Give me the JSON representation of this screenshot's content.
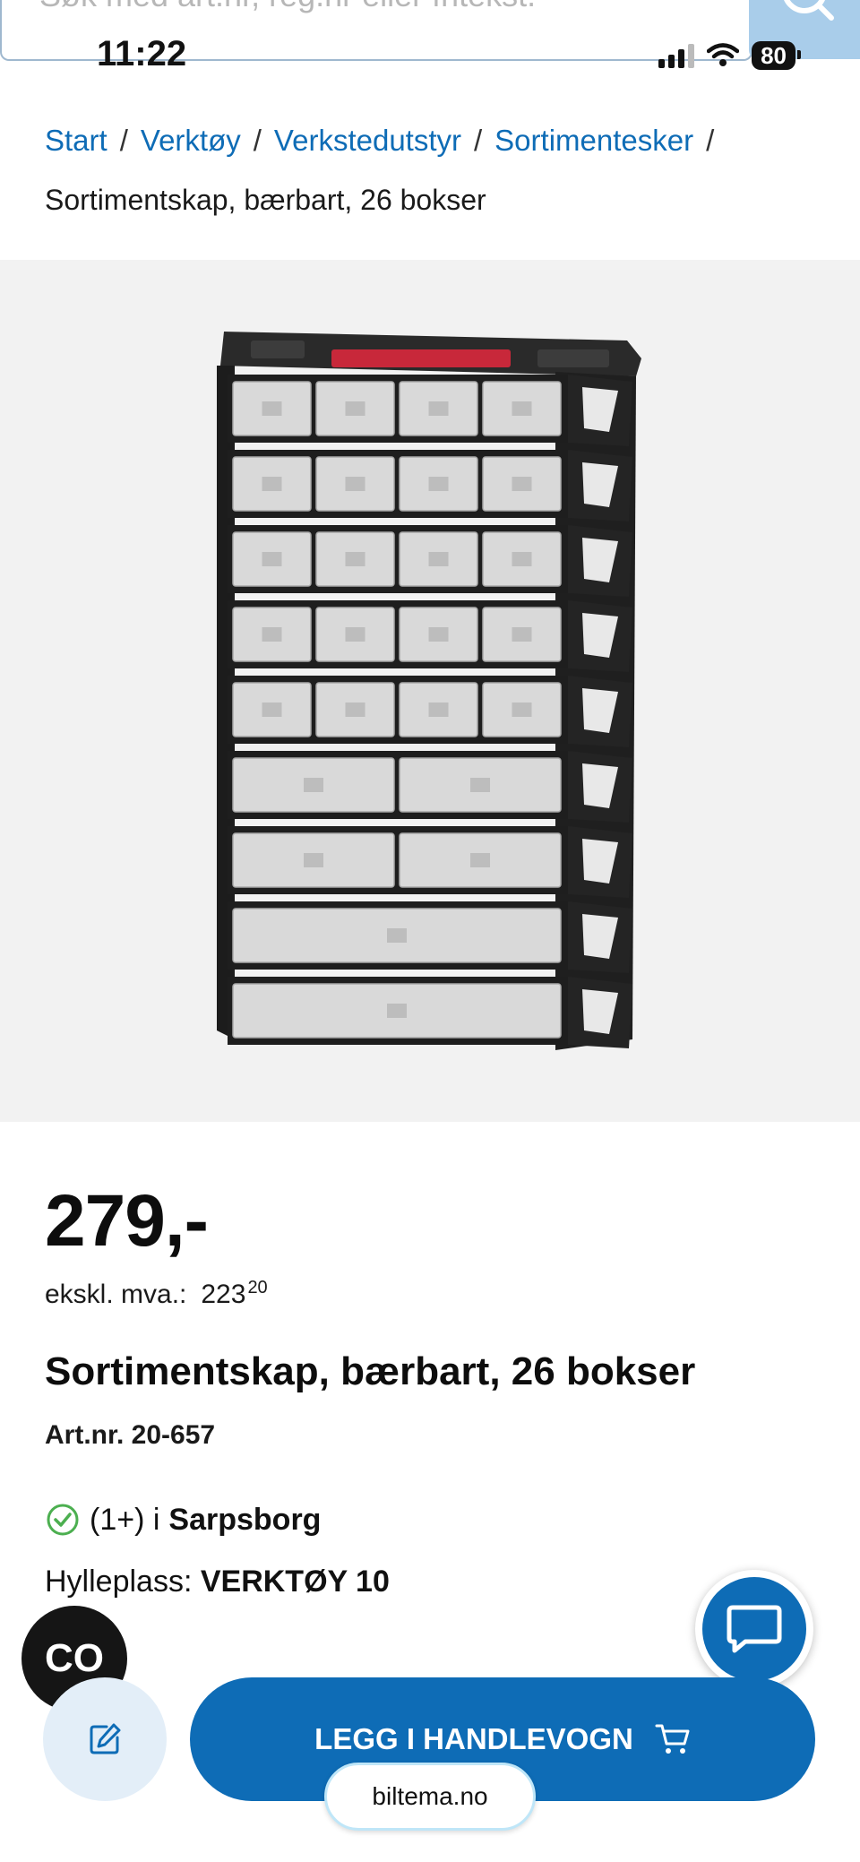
{
  "search": {
    "placeholder": "Søk med art.nr, reg.nr eller fritekst."
  },
  "status_bar": {
    "time": "11:22",
    "battery": "80"
  },
  "breadcrumb": {
    "items": [
      "Start",
      "Verktøy",
      "Verkstedutstyr",
      "Sortimentesker"
    ],
    "separator": "/",
    "current": "Sortimentskap, bærbart, 26 bokser"
  },
  "product": {
    "price": "279,-",
    "ex_vat_label": "ekskl. mva.:",
    "ex_vat_whole": "223",
    "ex_vat_cents": "20",
    "title": "Sortimentskap, bærbart, 26 bokser",
    "art_nr": "Art.nr. 20-657",
    "stock_count": "(1+) i",
    "stock_store": "Sarpsborg",
    "shelf_label": "Hylleplass:",
    "shelf_location": "VERKTØY 10"
  },
  "actions": {
    "add_to_cart": "LEGG I HANDLEVOGN"
  },
  "badge": {
    "text": "CO"
  },
  "browser": {
    "url": "biltema.no"
  },
  "colors": {
    "brand_blue": "#0e6cb6",
    "image_bg": "#f2f2f2",
    "check_green": "#4caf50"
  },
  "icons": [
    "search-icon",
    "check-circle-icon",
    "chat-icon",
    "edit-icon",
    "cart-icon",
    "signal-icon",
    "wifi-icon",
    "battery-icon"
  ]
}
